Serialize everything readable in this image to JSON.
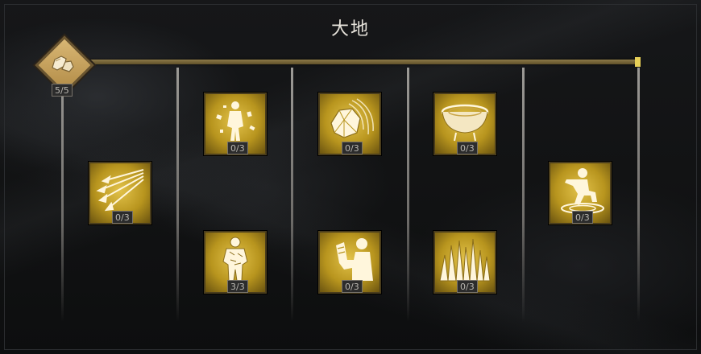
{
  "title": "大地",
  "root": {
    "icon": "boulder-icon",
    "rank": "5/5"
  },
  "columns": [
    {
      "skills": [
        {
          "icon": "spear-volley-icon",
          "rank": "0/3"
        }
      ]
    },
    {
      "skills": [
        {
          "icon": "shattering-warrior-icon",
          "rank": "0/3"
        },
        {
          "icon": "stone-golem-icon",
          "rank": "3/3"
        }
      ]
    },
    {
      "skills": [
        {
          "icon": "hurled-boulder-icon",
          "rank": "0/3"
        },
        {
          "icon": "flexing-arm-icon",
          "rank": "0/3"
        }
      ]
    },
    {
      "skills": [
        {
          "icon": "earthen-bowl-icon",
          "rank": "0/3"
        },
        {
          "icon": "stone-spikes-icon",
          "rank": "0/3"
        }
      ]
    },
    {
      "skills": [
        {
          "icon": "earth-stomp-icon",
          "rank": "0/3"
        }
      ]
    }
  ],
  "colors": {
    "gold": "#e2c24a",
    "track": "#8d7a48",
    "track_cap": "#e7cf57"
  }
}
